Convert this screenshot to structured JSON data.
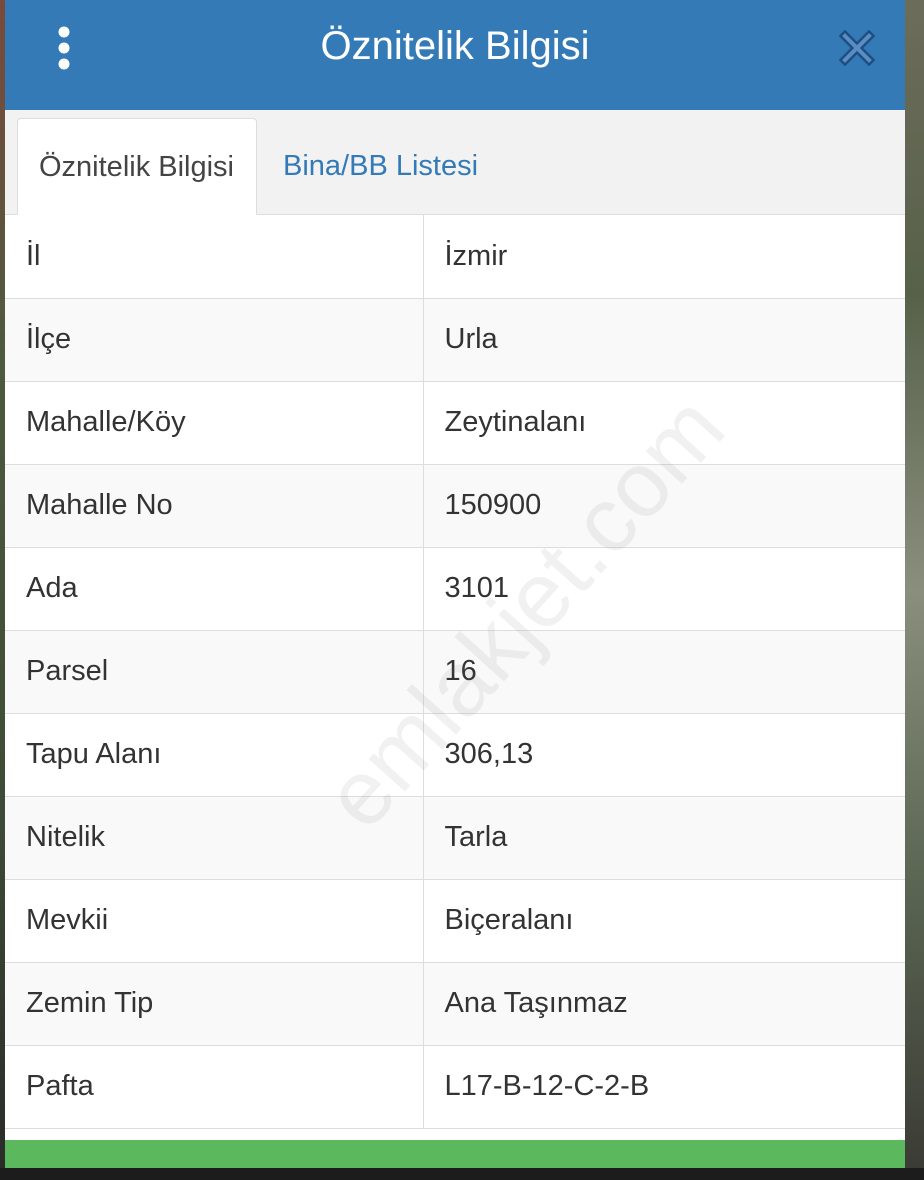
{
  "header": {
    "title": "Öznitelik Bilgisi",
    "menu_icon": "vertical-dots-icon",
    "close_icon": "close-icon",
    "color": "#337ab7"
  },
  "tabs": [
    {
      "label": "Öznitelik Bilgisi",
      "active": true
    },
    {
      "label": "Bina/BB Listesi",
      "active": false
    }
  ],
  "attributes": [
    {
      "key": "İl",
      "value": "İzmir"
    },
    {
      "key": "İlçe",
      "value": "Urla"
    },
    {
      "key": "Mahalle/Köy",
      "value": "Zeytinalanı"
    },
    {
      "key": "Mahalle No",
      "value": "150900"
    },
    {
      "key": "Ada",
      "value": "3101"
    },
    {
      "key": "Parsel",
      "value": "16"
    },
    {
      "key": "Tapu Alanı",
      "value": "306,13"
    },
    {
      "key": "Nitelik",
      "value": "Tarla"
    },
    {
      "key": "Mevkii",
      "value": "Biçeralanı"
    },
    {
      "key": "Zemin Tip",
      "value": "Ana Taşınmaz"
    },
    {
      "key": "Pafta",
      "value": "L17-B-12-C-2-B"
    }
  ],
  "watermark": "emlakjet.com",
  "footer_color": "#5cb85c"
}
